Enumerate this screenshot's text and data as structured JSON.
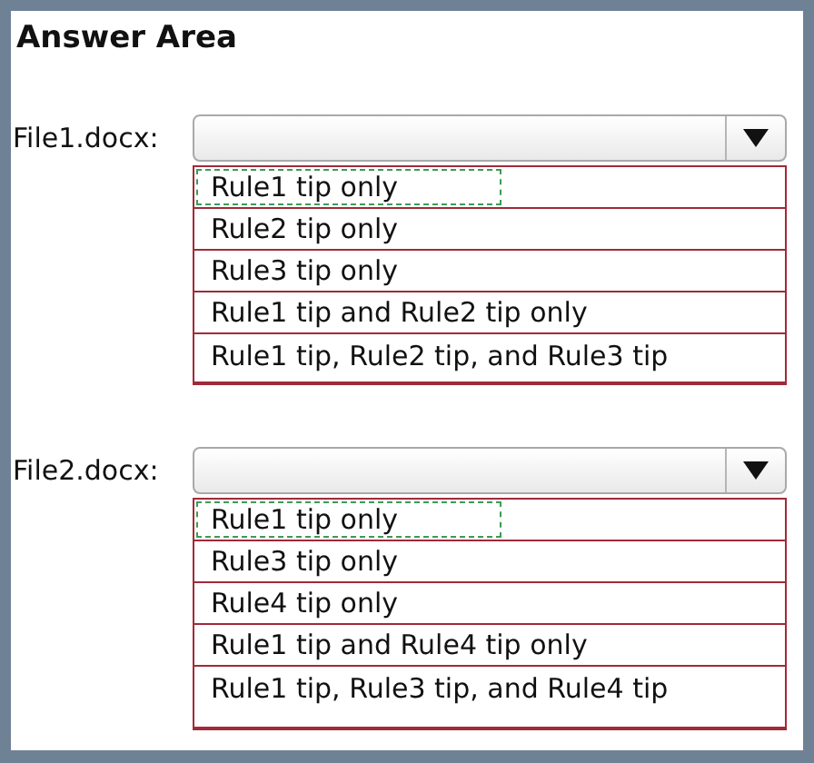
{
  "title": "Answer Area",
  "questions": [
    {
      "label": "File1.docx:",
      "expanded": true,
      "options": [
        {
          "text": "Rule1 tip only",
          "selected": true
        },
        {
          "text": "Rule2 tip only",
          "selected": false
        },
        {
          "text": "Rule3 tip only",
          "selected": false
        },
        {
          "text": "Rule1 tip and Rule2 tip only",
          "selected": false
        },
        {
          "text": "Rule1 tip, Rule2 tip, and Rule3 tip",
          "selected": false
        }
      ]
    },
    {
      "label": "File2.docx:",
      "expanded": true,
      "options": [
        {
          "text": "Rule1 tip only",
          "selected": true
        },
        {
          "text": "Rule3 tip only",
          "selected": false
        },
        {
          "text": "Rule4 tip only",
          "selected": false
        },
        {
          "text": "Rule1 tip and Rule4 tip only",
          "selected": false
        },
        {
          "text": "Rule1 tip, Rule3 tip, and Rule4 tip",
          "selected": false
        }
      ]
    }
  ]
}
